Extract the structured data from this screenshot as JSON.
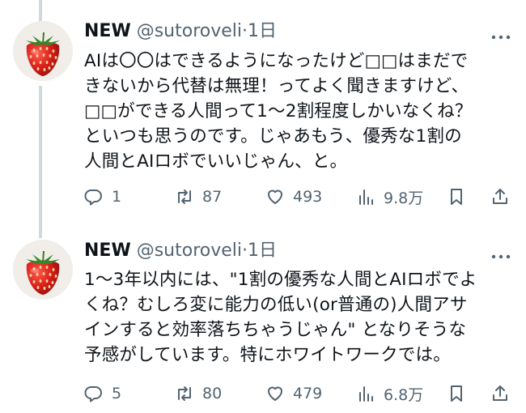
{
  "tweets": [
    {
      "display_name": "NEW",
      "handle": "@sutoroveli",
      "separator": "·",
      "time": "1日",
      "body": "AIは〇〇はできるようになったけど□□はまだで\nきないから代替は無理！ってよく聞きますけど、\n□□ができる人間って1〜2割程度しかいなくね？\nといつも思うのです。じゃあもう、優秀な1割の\n人間とAIロボでいいじゃん、と。",
      "replies": "1",
      "reposts": "87",
      "likes": "493",
      "views": "9.8万"
    },
    {
      "display_name": "NEW",
      "handle": "@sutoroveli",
      "separator": "·",
      "time": "1日",
      "body": "1〜3年以内には、\"1割の優秀な人間とAIロボでよ\nくね？むしろ変に能力の低い(or普通の)人間アサ\nインすると効率落ちちゃうじゃん\" となりそうな\n予感がしています。特にホワイトワークでは。",
      "replies": "5",
      "reposts": "80",
      "likes": "479",
      "views": "6.8万"
    }
  ],
  "icons": {
    "reply": "reply-icon",
    "repost": "repost-icon",
    "like": "heart-icon",
    "views": "views-icon",
    "bookmark": "bookmark-icon",
    "share": "share-icon",
    "more": "more-icon",
    "avatar": "strawberry-avatar"
  },
  "colors": {
    "text": "#0f1419",
    "secondary": "#536471",
    "thread_line": "#cfd9de"
  }
}
